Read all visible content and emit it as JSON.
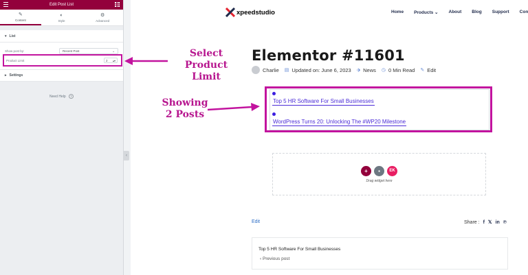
{
  "panel": {
    "title": "Edit Post List",
    "tabs": [
      {
        "icon": "✎",
        "label": "Content"
      },
      {
        "icon": "◐",
        "label": "Style"
      },
      {
        "icon": "⚙",
        "label": "Advanced"
      }
    ],
    "list_section": "List",
    "show_post_by_label": "Show post by:",
    "show_post_by_value": "Recent Post",
    "product_limit_label": "Product Limit",
    "product_limit_value": "2",
    "settings_section": "Settings",
    "need_help": "Need Help"
  },
  "site": {
    "logo_text": "xpeedstudio",
    "nav": [
      "Home",
      "Products",
      "About",
      "Blog",
      "Support",
      "Cont"
    ]
  },
  "annotations": {
    "select_limit": "Select Product\nLimit",
    "showing_posts": "Showing\n2 Posts"
  },
  "post": {
    "title": "Elementor #11601",
    "author": "Charlie",
    "updated": "Updated on: June 6, 2023",
    "category": "News",
    "read_time": "0 Min Read",
    "edit_label": "Edit"
  },
  "post_list": [
    "Top 5 HR Software For Small Businesses",
    "WordPress Turns 20: Unlocking The #WP20 Milestone"
  ],
  "drop_zone": {
    "text": "Drag widget here"
  },
  "footer": {
    "edit": "Edit",
    "share_label": "Share :",
    "share_icons": [
      "f",
      "𝕏",
      "in",
      "℗"
    ],
    "nav_card_title": "Top 5 HR Software For Small Businesses",
    "previous": "Previous post"
  },
  "colors": {
    "accent": "#93003c",
    "annotation": "#c2139e",
    "link": "#4a2bd7"
  }
}
